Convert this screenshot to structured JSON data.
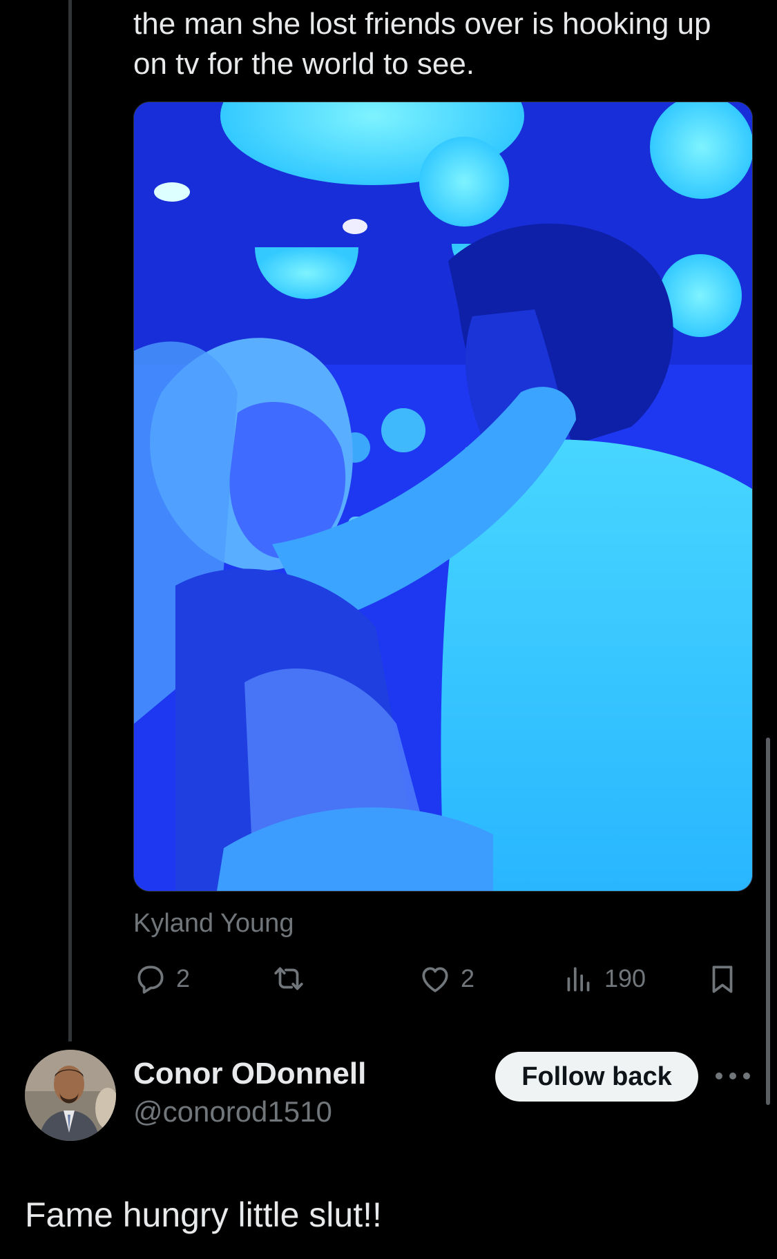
{
  "parent_tweet": {
    "text_lines": [
      "the man she lost friends over is hooking up",
      "on tv for the world to see."
    ],
    "media_caption": "Kyland Young",
    "actions": {
      "reply_count": "2",
      "repost_count": "",
      "like_count": "2",
      "views_count": "190"
    }
  },
  "reply": {
    "display_name": "Conor ODonnell",
    "handle": "@conorod1510",
    "follow_button_label": "Follow back",
    "text": "Fame hungry little slut!!"
  },
  "icons": {
    "reply": "speech-bubble-icon",
    "repost": "repost-icon",
    "like": "heart-icon",
    "views": "bar-chart-icon",
    "bookmark": "bookmark-icon",
    "more": "more-dots-icon"
  },
  "colors": {
    "background": "#000000",
    "text_primary": "#e7e9ea",
    "text_secondary": "#71767b",
    "button_bg": "#eff3f4",
    "media_tint": "#1f3dff"
  }
}
